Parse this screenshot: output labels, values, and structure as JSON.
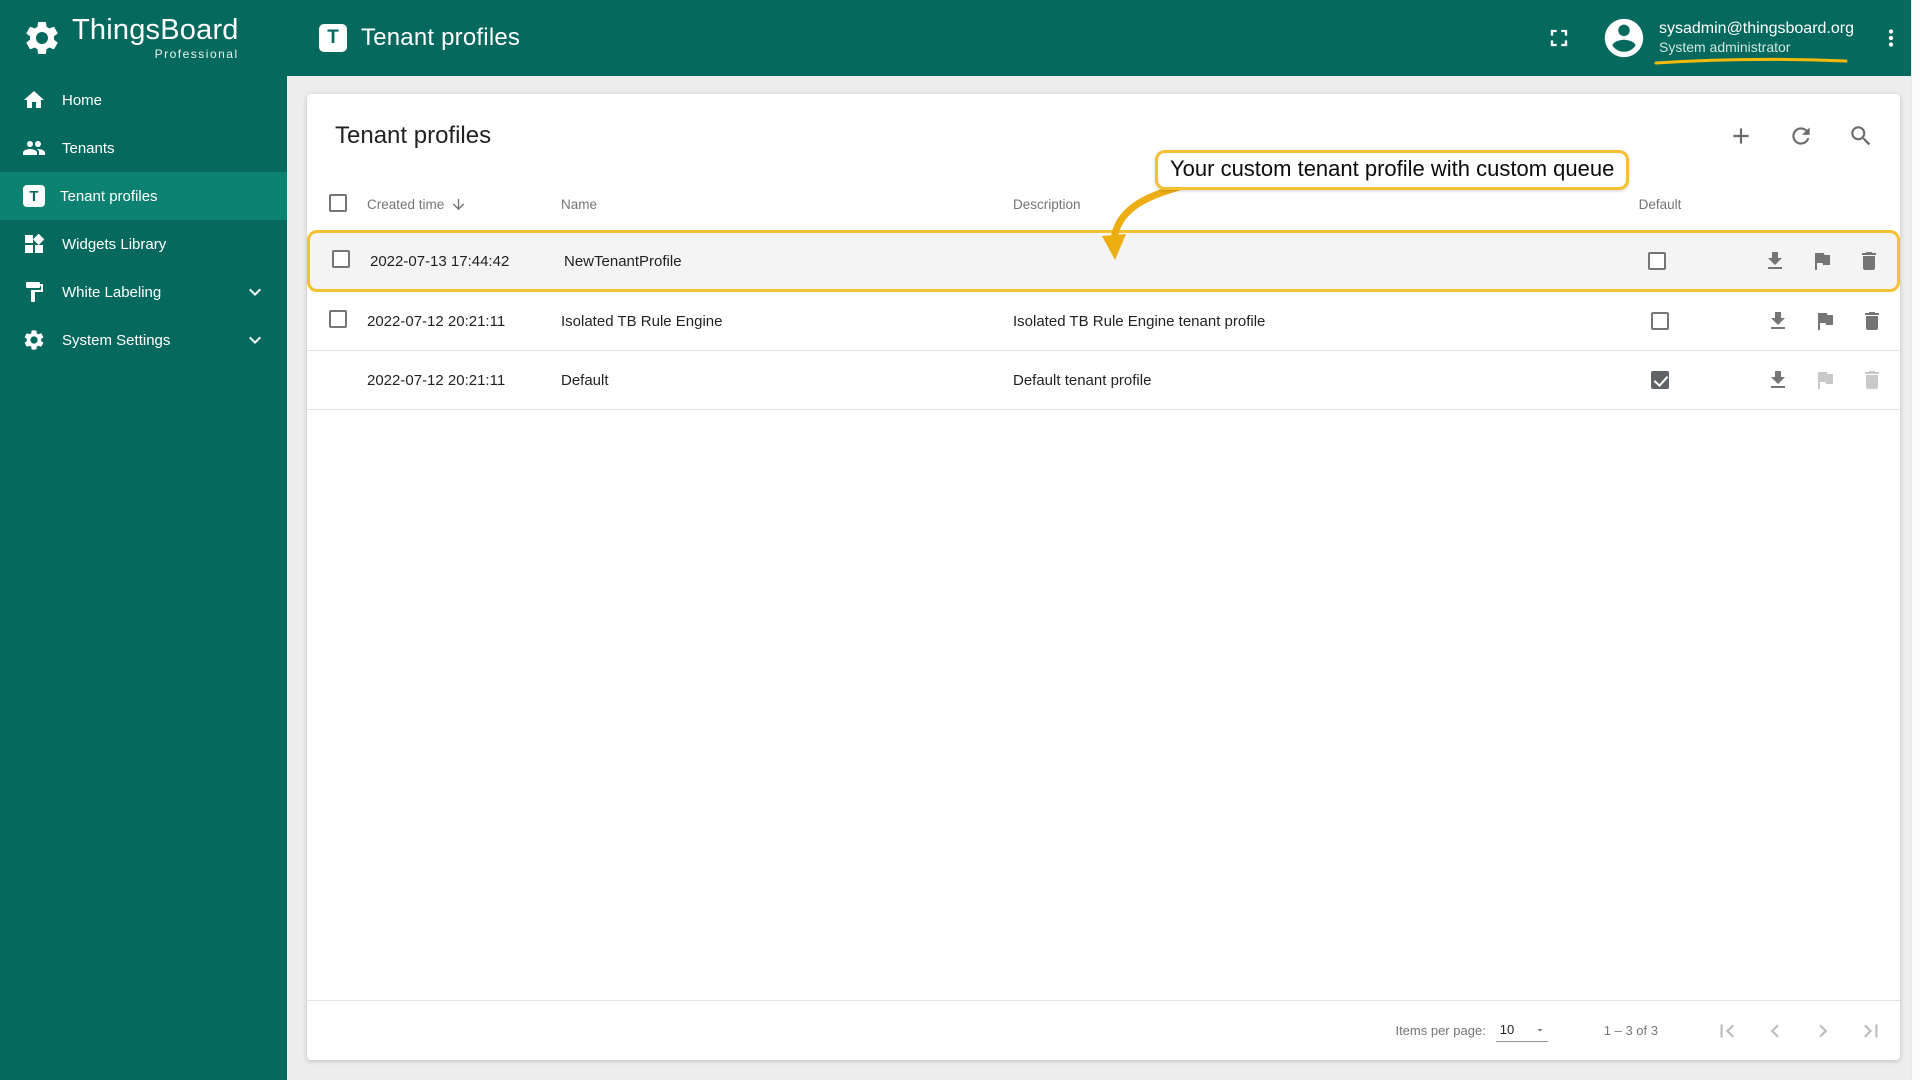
{
  "brand": {
    "name": "ThingsBoard",
    "subtitle": "Professional"
  },
  "header": {
    "title": "Tenant profiles",
    "user": {
      "email": "sysadmin@thingsboard.org",
      "role": "System administrator"
    },
    "icons": [
      "fullscreen-icon",
      "account-circle-icon",
      "more-vert-icon"
    ]
  },
  "sidebar": {
    "items": [
      {
        "label": "Home",
        "icon": "home-icon",
        "active": false,
        "expandable": false
      },
      {
        "label": "Tenants",
        "icon": "people-icon",
        "active": false,
        "expandable": false
      },
      {
        "label": "Tenant profiles",
        "icon": "tenant-profile-badge-icon",
        "active": true,
        "expandable": false
      },
      {
        "label": "Widgets Library",
        "icon": "widgets-icon",
        "active": false,
        "expandable": false
      },
      {
        "label": "White Labeling",
        "icon": "paint-icon",
        "active": false,
        "expandable": true
      },
      {
        "label": "System Settings",
        "icon": "gear-icon",
        "active": false,
        "expandable": true
      }
    ]
  },
  "main": {
    "card_title": "Tenant profiles",
    "toolbar_icons": [
      "add-icon",
      "refresh-icon",
      "search-icon"
    ],
    "table": {
      "headers": {
        "created": "Created time",
        "name": "Name",
        "description": "Description",
        "default": "Default"
      },
      "rows": [
        {
          "created": "2022-07-13 17:44:42",
          "name": "NewTenantProfile",
          "description": "",
          "default_checked": false,
          "selectable": true,
          "highlighted": true,
          "flag_enabled": true,
          "delete_enabled": true
        },
        {
          "created": "2022-07-12 20:21:11",
          "name": "Isolated TB Rule Engine",
          "description": "Isolated TB Rule Engine tenant profile",
          "default_checked": false,
          "selectable": true,
          "highlighted": false,
          "flag_enabled": true,
          "delete_enabled": true
        },
        {
          "created": "2022-07-12 20:21:11",
          "name": "Default",
          "description": "Default tenant profile",
          "default_checked": true,
          "selectable": false,
          "highlighted": false,
          "flag_enabled": false,
          "delete_enabled": false
        }
      ],
      "row_action_icons": [
        "download-icon",
        "flag-icon",
        "delete-icon"
      ]
    },
    "pagination": {
      "items_per_page_label": "Items per page:",
      "items_per_page_value": "10",
      "range_text": "1 – 3 of 3",
      "nav_icons": [
        "first-page-icon",
        "prev-page-icon",
        "next-page-icon",
        "last-page-icon"
      ]
    }
  },
  "annotation": {
    "text": "Your custom tenant profile with custom queue",
    "accent_color": "#F5C132",
    "arrow_color": "#EDAE12"
  },
  "icons": {
    "tenant_badge_glyph": "T"
  },
  "colors": {
    "primary_teal": "#05695E",
    "active_teal": "#0D8172",
    "gold": "#F5C132",
    "card_bg": "#FFFFFF",
    "content_bg": "#EDEDED"
  }
}
